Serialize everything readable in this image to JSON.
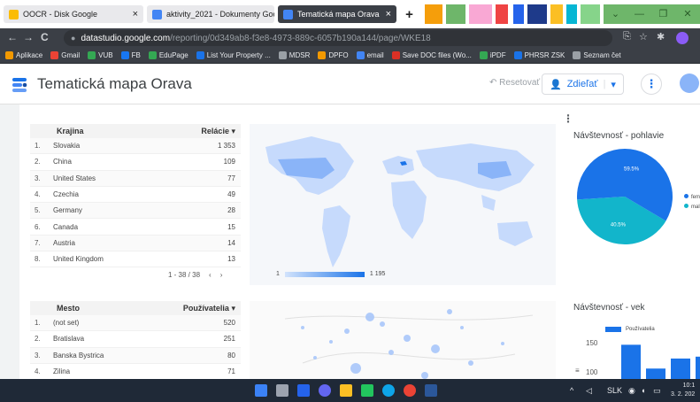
{
  "browser": {
    "tabs": [
      {
        "title": "OOCR - Disk Google",
        "favicon_color": "#fbbc04"
      },
      {
        "title": "aktivity_2021 - Dokumenty Goog",
        "favicon_color": "#4285f4"
      },
      {
        "title": "Tematická mapa Orava",
        "favicon_color": "#4285f4"
      }
    ],
    "close_glyph": "×",
    "new_tab_glyph": "+",
    "window_buttons": [
      "⌄",
      "—",
      "❐",
      "✕"
    ]
  },
  "address": {
    "back": "←",
    "forward": "→",
    "reload": "C",
    "lock": "🔒",
    "host": "datastudio.google.com",
    "path": "/reporting/0d349ab8-f3e8-4973-889c-6057b190a144/page/WKE18"
  },
  "bookmarks": [
    {
      "label": "Aplikace",
      "color": "#ea4335"
    },
    {
      "label": "Gmail",
      "color": "#ea4335"
    },
    {
      "label": "VUB",
      "color": "#34a853"
    },
    {
      "label": "FB",
      "color": "#1877f2"
    },
    {
      "label": "EduPage",
      "color": "#34a853"
    },
    {
      "label": "List Your Property ...",
      "color": "#1a73e8"
    },
    {
      "label": "MDSR",
      "color": "#9aa0a6"
    },
    {
      "label": "DPFO",
      "color": "#f29900"
    },
    {
      "label": "email",
      "color": "#4285f4"
    },
    {
      "label": "Save DOC files (Wo...",
      "color": "#d93025"
    },
    {
      "label": "iPDF",
      "color": "#34a853"
    },
    {
      "label": "PHRSR ZSK",
      "color": "#1a73e8"
    },
    {
      "label": "Seznam čet",
      "color": "#9aa0a6"
    }
  ],
  "header": {
    "title": "Tematická mapa Orava",
    "reset_label": "Resetovať",
    "share_label": "Zdieľať",
    "more_glyph": "⋮"
  },
  "country_table": {
    "col_name": "Krajina",
    "col_value": "Relácie",
    "rows": [
      {
        "idx": "1.",
        "name": "Slovakia",
        "value": "1 353"
      },
      {
        "idx": "2.",
        "name": "China",
        "value": "109"
      },
      {
        "idx": "3.",
        "name": "United States",
        "value": "77"
      },
      {
        "idx": "4.",
        "name": "Czechia",
        "value": "49"
      },
      {
        "idx": "5.",
        "name": "Germany",
        "value": "28"
      },
      {
        "idx": "6.",
        "name": "Canada",
        "value": "15"
      },
      {
        "idx": "7.",
        "name": "Austria",
        "value": "14"
      },
      {
        "idx": "8.",
        "name": "United Kingdom",
        "value": "13"
      }
    ],
    "pager_text": "1 - 38 / 38",
    "pager_prev": "‹",
    "pager_next": "›"
  },
  "map_legend": {
    "min": "1",
    "max": "1 195"
  },
  "city_table": {
    "col_name": "Mesto",
    "col_value": "Používatelia",
    "rows": [
      {
        "idx": "1.",
        "name": "(not set)",
        "value": "520"
      },
      {
        "idx": "2.",
        "name": "Bratislava",
        "value": "251"
      },
      {
        "idx": "3.",
        "name": "Banska Bystrica",
        "value": "80"
      },
      {
        "idx": "4.",
        "name": "Zilina",
        "value": "71"
      }
    ]
  },
  "gender_chart": {
    "title": "Návštevnosť - pohlavie",
    "slices": [
      {
        "label": "femal",
        "pct_text": "40.5%",
        "value": 40.5,
        "color": "#12b5cb"
      },
      {
        "label": "mal",
        "pct_text": "59.5%",
        "value": 59.5,
        "color": "#1a73e8"
      }
    ]
  },
  "age_chart": {
    "title": "Návštevnosť - vek",
    "legend": "Používatelia",
    "ytick_top": "150",
    "ytick_bottom": "100",
    "bar_levels": [
      0.92,
      0.28,
      0.55,
      0.6
    ]
  },
  "taskbar": {
    "tray_language": "SLK",
    "time": "10:1",
    "date": "3. 2. 202"
  }
}
